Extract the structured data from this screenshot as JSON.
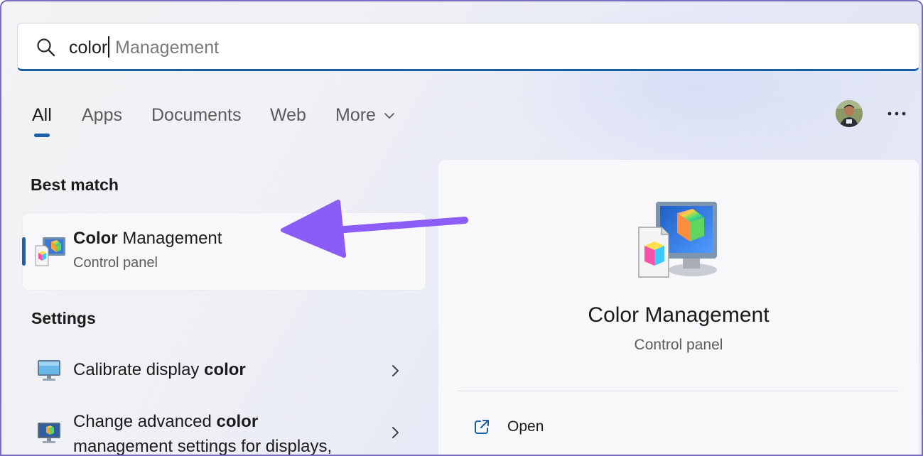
{
  "search": {
    "typed": "color",
    "suggestion": " Management"
  },
  "tabs": [
    {
      "label": "All"
    },
    {
      "label": "Apps"
    },
    {
      "label": "Documents"
    },
    {
      "label": "Web"
    },
    {
      "label": "More"
    }
  ],
  "best_match": {
    "heading": "Best match",
    "title_bold": "Color",
    "title_rest": " Management",
    "subtitle": "Control panel"
  },
  "settings": {
    "heading": "Settings",
    "items": [
      {
        "before": "Calibrate display ",
        "bold": "color",
        "after": ""
      },
      {
        "before": "Change advanced ",
        "bold": "color",
        "after": "",
        "line2": "management settings for displays,"
      }
    ]
  },
  "preview": {
    "title": "Color Management",
    "subtitle": "Control panel",
    "open_label": "Open"
  },
  "colors": {
    "accent": "#1a5fa8",
    "annotation_arrow": "#8b5cf6"
  },
  "icons": {
    "search": "search-icon",
    "more_menu": "ellipsis-icon",
    "open": "open-external-icon"
  }
}
